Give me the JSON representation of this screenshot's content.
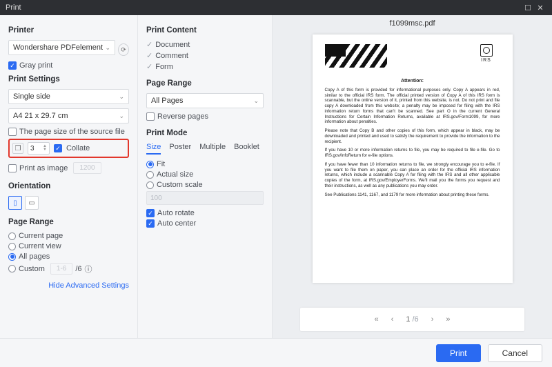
{
  "title": "Print",
  "window": {
    "min": "—",
    "max": "☐",
    "close": "✕"
  },
  "printer": {
    "heading": "Printer",
    "selected": "Wondershare PDFelement",
    "gray_label": "Gray print",
    "props_icon": "⟳"
  },
  "settings": {
    "heading": "Print Settings",
    "sides": "Single side",
    "paper": "A4 21 x 29.7 cm",
    "source_size_label": "The page size of the source file",
    "copies_value": "3",
    "collate_label": "Collate",
    "print_as_image_label": "Print as image",
    "print_as_image_hint": "1200"
  },
  "orientation": {
    "heading": "Orientation",
    "portrait_glyph": "▯",
    "landscape_glyph": "▭"
  },
  "pagerange_left": {
    "heading": "Page Range",
    "opt1": "Current page",
    "opt2": "Current view",
    "opt3": "All pages",
    "opt4": "Custom",
    "custom_hint": "1-6",
    "total": "/6",
    "info": "ⓘ"
  },
  "hide_link": "Hide Advanced Settings",
  "content": {
    "heading": "Print Content",
    "i1": "Document",
    "i2": "Comment",
    "i3": "Form"
  },
  "pagerange_mid": {
    "heading": "Page Range",
    "selected": "All Pages",
    "reverse_label": "Reverse pages"
  },
  "mode": {
    "heading": "Print Mode",
    "tab_size": "Size",
    "tab_poster": "Poster",
    "tab_multiple": "Multiple",
    "tab_booklet": "Booklet",
    "fit": "Fit",
    "actual": "Actual size",
    "custom": "Custom scale",
    "scale_hint": "100",
    "auto_rotate": "Auto rotate",
    "auto_center": "Auto center"
  },
  "preview": {
    "filename": "f1099msc.pdf",
    "irs_label": "IRS",
    "attention": "Attention:",
    "p1": "Copy A of this form is provided for informational purposes only. Copy A appears in red, similar to the official IRS form. The official printed version of Copy A of this IRS form is scannable, but the online version of it, printed from this website, is not. Do not print and file copy A downloaded from this website; a penalty may be imposed for filing with the IRS information return forms that can't be scanned. See part O in the current General Instructions for Certain Information Returns, available at IRS.gov/Form1099, for more information about penalties.",
    "p2": "Please note that Copy B and other copies of this form, which appear in black, may be downloaded and printed and used to satisfy the requirement to provide the information to the recipient.",
    "p3": "If you have 10 or more information returns to file, you may be required to file e-file. Go to IRS.gov/InfoReturn for e-file options.",
    "p4": "If you have fewer than 10 information returns to file, we strongly encourage you to e-file. If you want to file them on paper, you can place an order for the official IRS information returns, which include a scannable Copy A for filing with the IRS and all other applicable copies of the form, at IRS.gov/EmployerForms. We'll mail you the forms you request and their instructions, as well as any publications you may order.",
    "p5": "See Publications 1141, 1167, and 1179 for more information about printing these forms.",
    "pager_current": "1",
    "pager_total": "/6",
    "first": "«",
    "prev": "‹",
    "next": "›",
    "last": "»"
  },
  "footer": {
    "print": "Print",
    "cancel": "Cancel"
  }
}
